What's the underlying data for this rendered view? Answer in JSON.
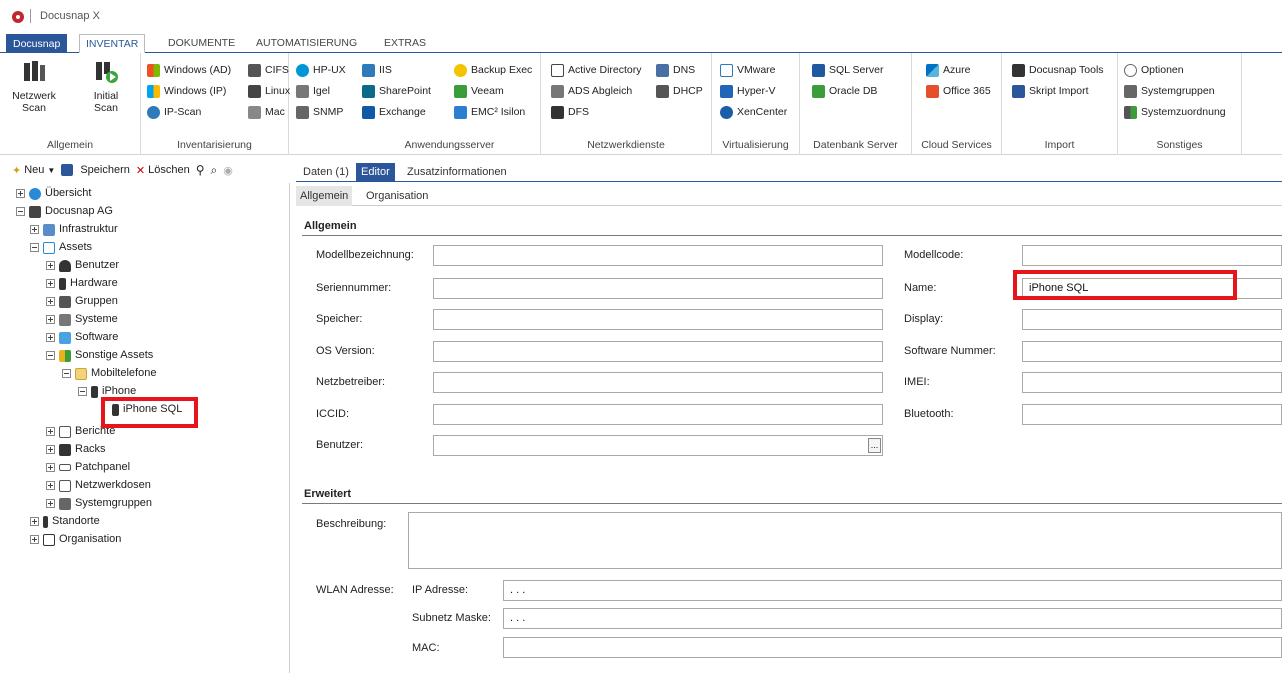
{
  "app": {
    "title": "Docusnap X"
  },
  "ribbon_tabs": [
    "Docusnap",
    "INVENTAR",
    "DOKUMENTE",
    "AUTOMATISIERUNG",
    "EXTRAS"
  ],
  "ribbon": {
    "allgemein": {
      "label": "Allgemein",
      "netzwerk_scan": "Netzwerk\nScan",
      "initial_scan": "Initial\nScan"
    },
    "inventarisierung": {
      "label": "Inventarisierung",
      "items": [
        "Windows (AD)",
        "CIFS",
        "HP-UX",
        "Windows (IP)",
        "Linux",
        "Igel",
        "IP-Scan",
        "Mac",
        "SNMP"
      ]
    },
    "anwendungsserver": {
      "label": "Anwendungsserver",
      "items": [
        "IIS",
        "Backup Exec",
        "SharePoint",
        "Veeam",
        "Exchange",
        "EMC² Isilon"
      ]
    },
    "netzwerkdienste": {
      "label": "Netzwerkdienste",
      "items": [
        "Active Directory",
        "DNS",
        "ADS Abgleich",
        "DHCP",
        "DFS"
      ]
    },
    "virtualisierung": {
      "label": "Virtualisierung",
      "items": [
        "VMware",
        "Hyper-V",
        "XenCenter"
      ]
    },
    "datenbank": {
      "label": "Datenbank Server",
      "items": [
        "SQL Server",
        "Oracle DB"
      ]
    },
    "cloud": {
      "label": "Cloud Services",
      "items": [
        "Azure",
        "Office 365"
      ]
    },
    "import": {
      "label": "Import",
      "items": [
        "Docusnap Tools",
        "Skript Import"
      ]
    },
    "sonstiges": {
      "label": "Sonstiges",
      "items": [
        "Optionen",
        "Systemgruppen",
        "Systemzuordnung"
      ]
    }
  },
  "toolbar": {
    "neu": "Neu",
    "speichern": "Speichern",
    "loeschen": "Löschen"
  },
  "tree": [
    "Übersicht",
    "Docusnap AG",
    "Infrastruktur",
    "Assets",
    "Benutzer",
    "Hardware",
    "Gruppen",
    "Systeme",
    "Software",
    "Sonstige Assets",
    "Mobiltelefone",
    "iPhone",
    "iPhone SQL",
    "Berichte",
    "Racks",
    "Patchpanel",
    "Netzwerkdosen",
    "Systemgruppen",
    "Standorte",
    "Organisation"
  ],
  "panel": {
    "tabs": [
      "Daten (1)",
      "Editor",
      "Zusatzinformationen"
    ],
    "subtabs": [
      "Allgemein",
      "Organisation"
    ],
    "section_allgemein": "Allgemein",
    "section_erweitert": "Erweitert",
    "left_fields": [
      "Modellbezeichnung:",
      "Seriennummer:",
      "Speicher:",
      "OS Version:",
      "Netzbetreiber:",
      "ICCID:",
      "Benutzer:"
    ],
    "right_fields": [
      "Modellcode:",
      "Name:",
      "Display:",
      "Software Nummer:",
      "IMEI:",
      "Bluetooth:"
    ],
    "name_value": "iPhone SQL",
    "ellipsis": "...",
    "beschreibung": "Beschreibung:",
    "wlan": "WLAN Adresse:",
    "ip_label": "IP Adresse:",
    "subnet_label": "Subnetz Maske:",
    "mac_label": "MAC:",
    "ip_value": ". . .",
    "subnet_value": ". . ."
  },
  "colors": {
    "accent": "#2b579a",
    "highlight": "#e8141c"
  }
}
